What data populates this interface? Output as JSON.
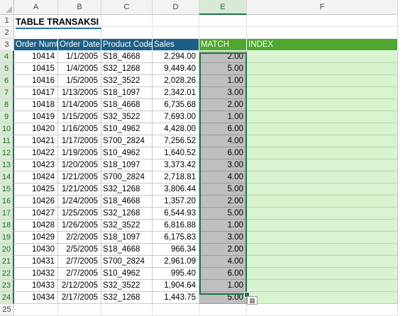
{
  "columns": [
    "A",
    "B",
    "C",
    "D",
    "E",
    "F"
  ],
  "selected_column": "E",
  "rows": [
    "1",
    "2",
    "3",
    "4",
    "5",
    "6",
    "7",
    "8",
    "9",
    "10",
    "11",
    "12",
    "13",
    "14",
    "15",
    "16",
    "17",
    "18",
    "19",
    "20",
    "21",
    "22",
    "23",
    "24",
    "25"
  ],
  "title": "TABLE TRANSAKSI",
  "headers": {
    "order_number": "Order Numt",
    "order_date": "Order Date",
    "product_code": "Product Code",
    "sales": "Sales",
    "match": "MATCH",
    "index": "INDEX"
  },
  "colors": {
    "header_blue": "#1b5e86",
    "header_green": "#4ea72e",
    "match_fill": "#bfbfbf",
    "index_fill": "#d9f2d0",
    "selection": "#217346"
  },
  "data": [
    [
      "10414",
      "1/1/2005",
      "S18_4668",
      "2,294.00",
      "2.00"
    ],
    [
      "10415",
      "1/4/2005",
      "S32_1268",
      "9,449.40",
      "5.00"
    ],
    [
      "10416",
      "1/5/2005",
      "S32_3522",
      "2,028.26",
      "1.00"
    ],
    [
      "10417",
      "1/13/2005",
      "S18_1097",
      "2,342.01",
      "3.00"
    ],
    [
      "10418",
      "1/14/2005",
      "S18_4668",
      "6,735.68",
      "2.00"
    ],
    [
      "10419",
      "1/15/2005",
      "S32_3522",
      "7,693.00",
      "1.00"
    ],
    [
      "10420",
      "1/16/2005",
      "S10_4962",
      "4,428.00",
      "6.00"
    ],
    [
      "10421",
      "1/17/2005",
      "S700_2824",
      "7,256.52",
      "4.00"
    ],
    [
      "10422",
      "1/19/2005",
      "S10_4962",
      "1,640.52",
      "6.00"
    ],
    [
      "10423",
      "1/20/2005",
      "S18_1097",
      "3,373.42",
      "3.00"
    ],
    [
      "10424",
      "1/21/2005",
      "S700_2824",
      "2,718.81",
      "4.00"
    ],
    [
      "10425",
      "1/21/2005",
      "S32_1268",
      "3,806.44",
      "5.00"
    ],
    [
      "10426",
      "1/24/2005",
      "S18_4668",
      "1,357.20",
      "2.00"
    ],
    [
      "10427",
      "1/25/2005",
      "S32_1268",
      "6,544.93",
      "5.00"
    ],
    [
      "10428",
      "1/26/2005",
      "S32_3522",
      "6,816.88",
      "1.00"
    ],
    [
      "10429",
      "2/2/2005",
      "S18_1097",
      "6,175.83",
      "3.00"
    ],
    [
      "10430",
      "2/5/2005",
      "S18_4668",
      "966.34",
      "2.00"
    ],
    [
      "10431",
      "2/7/2005",
      "S700_2824",
      "2,961.09",
      "4.00"
    ],
    [
      "10432",
      "2/7/2005",
      "S10_4962",
      "995.40",
      "6.00"
    ],
    [
      "10433",
      "2/12/2005",
      "S32_3522",
      "1,904.64",
      "1.00"
    ],
    [
      "10434",
      "2/17/2005",
      "S32_1268",
      "1,443.75",
      "5.00"
    ]
  ]
}
